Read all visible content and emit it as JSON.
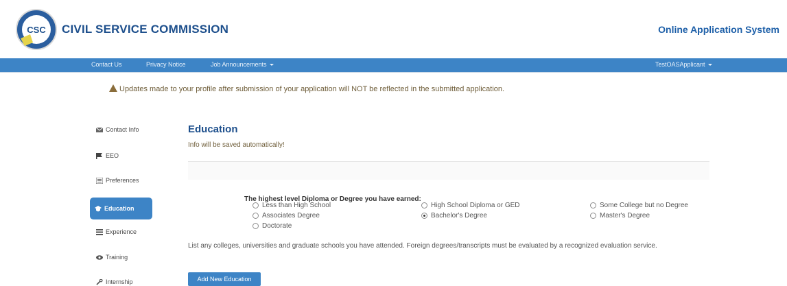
{
  "header": {
    "logo_text": "CSC",
    "title": "CIVIL SERVICE COMMISSION",
    "right_title": "Online Application System"
  },
  "navbar": {
    "items": [
      "Contact Us",
      "Privacy Notice",
      "Job Announcements"
    ],
    "user": "TestOASApplicant"
  },
  "warning": "Updates made to your profile after submission of your application will NOT be reflected in the submitted application.",
  "sidebar": {
    "items": [
      {
        "label": "Contact Info",
        "icon": "envelope-icon"
      },
      {
        "label": "EEO",
        "icon": "flag-icon"
      },
      {
        "label": "Preferences",
        "icon": "list-icon"
      },
      {
        "label": "Education",
        "icon": "graduation-cap-icon",
        "active": true
      },
      {
        "label": "Experience",
        "icon": "list-icon"
      },
      {
        "label": "Training",
        "icon": "eye-icon"
      },
      {
        "label": "Internship",
        "icon": "wrench-icon"
      }
    ]
  },
  "main": {
    "title": "Education",
    "autosave_note": "Info will be saved automatically!",
    "question": "The highest level Diploma or Degree you have earned:",
    "options": [
      {
        "label": "Less than High School",
        "checked": false
      },
      {
        "label": "High School Diploma or GED",
        "checked": false
      },
      {
        "label": "Some College but no Degree",
        "checked": false
      },
      {
        "label": "Associates Degree",
        "checked": false
      },
      {
        "label": "Bachelor's Degree",
        "checked": true
      },
      {
        "label": "Master's Degree",
        "checked": false
      },
      {
        "label": "Doctorate",
        "checked": false
      }
    ],
    "note": "List any colleges, universities and graduate schools you have attended. Foreign degrees/transcripts must be evaluated by a recognized evaluation service.",
    "add_button": "Add New Education"
  },
  "colors": {
    "navbar": "#3d84c6",
    "brand_blue": "#1d4f8c",
    "warning_text": "#6f5e3a"
  }
}
